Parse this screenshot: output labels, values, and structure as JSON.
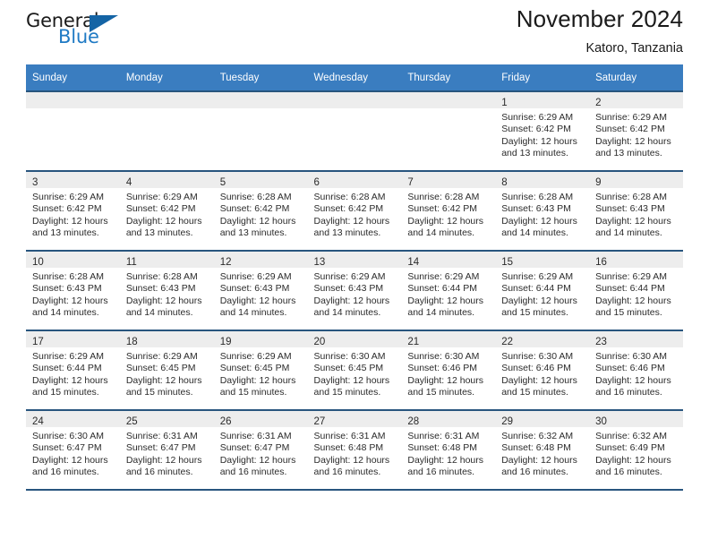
{
  "brand": {
    "name_part1": "General",
    "name_part2": "Blue",
    "triangle_color": "#1464a5",
    "blue_color": "#1f7ac4"
  },
  "header": {
    "title": "November 2024",
    "subtitle": "Katoro, Tanzania"
  },
  "theme": {
    "header_bar": "#3a7dc0",
    "cell_rule": "#28557e",
    "daynum_band": "#ededed",
    "text": "#2b2b2b"
  },
  "weekdays": [
    "Sunday",
    "Monday",
    "Tuesday",
    "Wednesday",
    "Thursday",
    "Friday",
    "Saturday"
  ],
  "labels": {
    "sunrise": "Sunrise:",
    "sunset": "Sunset:",
    "daylight": "Daylight:"
  },
  "weeks": [
    [
      {
        "day": ""
      },
      {
        "day": ""
      },
      {
        "day": ""
      },
      {
        "day": ""
      },
      {
        "day": ""
      },
      {
        "day": "1",
        "sunrise": "Sunrise: 6:29 AM",
        "sunset": "Sunset: 6:42 PM",
        "daylight1": "Daylight: 12 hours",
        "daylight2": "and 13 minutes."
      },
      {
        "day": "2",
        "sunrise": "Sunrise: 6:29 AM",
        "sunset": "Sunset: 6:42 PM",
        "daylight1": "Daylight: 12 hours",
        "daylight2": "and 13 minutes."
      }
    ],
    [
      {
        "day": "3",
        "sunrise": "Sunrise: 6:29 AM",
        "sunset": "Sunset: 6:42 PM",
        "daylight1": "Daylight: 12 hours",
        "daylight2": "and 13 minutes."
      },
      {
        "day": "4",
        "sunrise": "Sunrise: 6:29 AM",
        "sunset": "Sunset: 6:42 PM",
        "daylight1": "Daylight: 12 hours",
        "daylight2": "and 13 minutes."
      },
      {
        "day": "5",
        "sunrise": "Sunrise: 6:28 AM",
        "sunset": "Sunset: 6:42 PM",
        "daylight1": "Daylight: 12 hours",
        "daylight2": "and 13 minutes."
      },
      {
        "day": "6",
        "sunrise": "Sunrise: 6:28 AM",
        "sunset": "Sunset: 6:42 PM",
        "daylight1": "Daylight: 12 hours",
        "daylight2": "and 13 minutes."
      },
      {
        "day": "7",
        "sunrise": "Sunrise: 6:28 AM",
        "sunset": "Sunset: 6:42 PM",
        "daylight1": "Daylight: 12 hours",
        "daylight2": "and 14 minutes."
      },
      {
        "day": "8",
        "sunrise": "Sunrise: 6:28 AM",
        "sunset": "Sunset: 6:43 PM",
        "daylight1": "Daylight: 12 hours",
        "daylight2": "and 14 minutes."
      },
      {
        "day": "9",
        "sunrise": "Sunrise: 6:28 AM",
        "sunset": "Sunset: 6:43 PM",
        "daylight1": "Daylight: 12 hours",
        "daylight2": "and 14 minutes."
      }
    ],
    [
      {
        "day": "10",
        "sunrise": "Sunrise: 6:28 AM",
        "sunset": "Sunset: 6:43 PM",
        "daylight1": "Daylight: 12 hours",
        "daylight2": "and 14 minutes."
      },
      {
        "day": "11",
        "sunrise": "Sunrise: 6:28 AM",
        "sunset": "Sunset: 6:43 PM",
        "daylight1": "Daylight: 12 hours",
        "daylight2": "and 14 minutes."
      },
      {
        "day": "12",
        "sunrise": "Sunrise: 6:29 AM",
        "sunset": "Sunset: 6:43 PM",
        "daylight1": "Daylight: 12 hours",
        "daylight2": "and 14 minutes."
      },
      {
        "day": "13",
        "sunrise": "Sunrise: 6:29 AM",
        "sunset": "Sunset: 6:43 PM",
        "daylight1": "Daylight: 12 hours",
        "daylight2": "and 14 minutes."
      },
      {
        "day": "14",
        "sunrise": "Sunrise: 6:29 AM",
        "sunset": "Sunset: 6:44 PM",
        "daylight1": "Daylight: 12 hours",
        "daylight2": "and 14 minutes."
      },
      {
        "day": "15",
        "sunrise": "Sunrise: 6:29 AM",
        "sunset": "Sunset: 6:44 PM",
        "daylight1": "Daylight: 12 hours",
        "daylight2": "and 15 minutes."
      },
      {
        "day": "16",
        "sunrise": "Sunrise: 6:29 AM",
        "sunset": "Sunset: 6:44 PM",
        "daylight1": "Daylight: 12 hours",
        "daylight2": "and 15 minutes."
      }
    ],
    [
      {
        "day": "17",
        "sunrise": "Sunrise: 6:29 AM",
        "sunset": "Sunset: 6:44 PM",
        "daylight1": "Daylight: 12 hours",
        "daylight2": "and 15 minutes."
      },
      {
        "day": "18",
        "sunrise": "Sunrise: 6:29 AM",
        "sunset": "Sunset: 6:45 PM",
        "daylight1": "Daylight: 12 hours",
        "daylight2": "and 15 minutes."
      },
      {
        "day": "19",
        "sunrise": "Sunrise: 6:29 AM",
        "sunset": "Sunset: 6:45 PM",
        "daylight1": "Daylight: 12 hours",
        "daylight2": "and 15 minutes."
      },
      {
        "day": "20",
        "sunrise": "Sunrise: 6:30 AM",
        "sunset": "Sunset: 6:45 PM",
        "daylight1": "Daylight: 12 hours",
        "daylight2": "and 15 minutes."
      },
      {
        "day": "21",
        "sunrise": "Sunrise: 6:30 AM",
        "sunset": "Sunset: 6:46 PM",
        "daylight1": "Daylight: 12 hours",
        "daylight2": "and 15 minutes."
      },
      {
        "day": "22",
        "sunrise": "Sunrise: 6:30 AM",
        "sunset": "Sunset: 6:46 PM",
        "daylight1": "Daylight: 12 hours",
        "daylight2": "and 15 minutes."
      },
      {
        "day": "23",
        "sunrise": "Sunrise: 6:30 AM",
        "sunset": "Sunset: 6:46 PM",
        "daylight1": "Daylight: 12 hours",
        "daylight2": "and 16 minutes."
      }
    ],
    [
      {
        "day": "24",
        "sunrise": "Sunrise: 6:30 AM",
        "sunset": "Sunset: 6:47 PM",
        "daylight1": "Daylight: 12 hours",
        "daylight2": "and 16 minutes."
      },
      {
        "day": "25",
        "sunrise": "Sunrise: 6:31 AM",
        "sunset": "Sunset: 6:47 PM",
        "daylight1": "Daylight: 12 hours",
        "daylight2": "and 16 minutes."
      },
      {
        "day": "26",
        "sunrise": "Sunrise: 6:31 AM",
        "sunset": "Sunset: 6:47 PM",
        "daylight1": "Daylight: 12 hours",
        "daylight2": "and 16 minutes."
      },
      {
        "day": "27",
        "sunrise": "Sunrise: 6:31 AM",
        "sunset": "Sunset: 6:48 PM",
        "daylight1": "Daylight: 12 hours",
        "daylight2": "and 16 minutes."
      },
      {
        "day": "28",
        "sunrise": "Sunrise: 6:31 AM",
        "sunset": "Sunset: 6:48 PM",
        "daylight1": "Daylight: 12 hours",
        "daylight2": "and 16 minutes."
      },
      {
        "day": "29",
        "sunrise": "Sunrise: 6:32 AM",
        "sunset": "Sunset: 6:48 PM",
        "daylight1": "Daylight: 12 hours",
        "daylight2": "and 16 minutes."
      },
      {
        "day": "30",
        "sunrise": "Sunrise: 6:32 AM",
        "sunset": "Sunset: 6:49 PM",
        "daylight1": "Daylight: 12 hours",
        "daylight2": "and 16 minutes."
      }
    ]
  ]
}
